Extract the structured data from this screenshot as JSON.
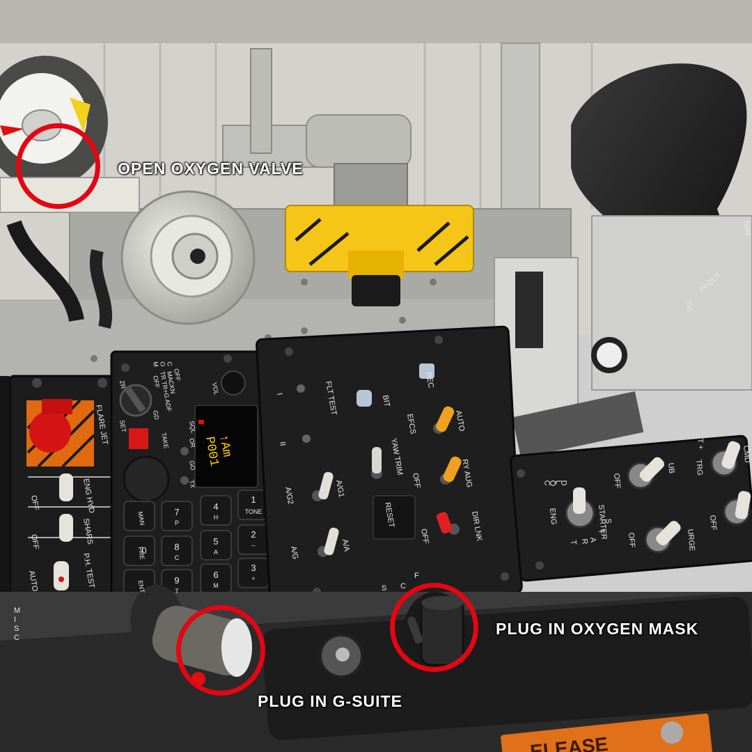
{
  "callouts": {
    "oxygen_valve": "OPEN OXYGEN VALVE",
    "oxygen_mask": "PLUG IN OXYGEN MASK",
    "g_suit": "PLUG IN G-SUITE"
  },
  "flt_test_panel": {
    "title": "FLT TEST",
    "rec": "REC",
    "bit": "BIT",
    "efcs": "EFCS",
    "auto": "AUTO",
    "yaw_trim": "YAW TRIM",
    "ry_aug": "RY AUG",
    "off1": "OFF",
    "off2": "OFF",
    "reset": "RESET",
    "dir_lnk": "DIR LNK",
    "ag1": "A/G1",
    "ag2": "A/G2",
    "ag": "A/G",
    "aa": "A/A",
    "pos_1": "I",
    "pos_2": "II",
    "fcs": [
      "F",
      "C",
      "S"
    ]
  },
  "ufc_panel": {
    "display_line1": "P001",
    "display_line2": "↑Am",
    "vol": "VOL",
    "tone": "TONE",
    "man": "MAN",
    "pre": "PRE",
    "ent": "ENT",
    "go": "GO",
    "tx": "TX",
    "sql": "SQL",
    "or": "OR",
    "take": "TAKE",
    "set": "SET",
    "zr": "ZR",
    "mode_labels": [
      "C",
      "O",
      "M",
      "OFF",
      "MACKN",
      "TR TR+G ADF",
      "OFF",
      "GD"
    ],
    "keys": [
      {
        "num": "1",
        "sub": ""
      },
      {
        "num": "4",
        "sub": "H"
      },
      {
        "num": "7",
        "sub": "P"
      },
      {
        "num": "2",
        "sub": "–"
      },
      {
        "num": "5",
        "sub": "A"
      },
      {
        "num": "8",
        "sub": "C"
      },
      {
        "num": "3",
        "sub": "+"
      },
      {
        "num": "6",
        "sub": "M"
      },
      {
        "num": "9",
        "sub": "T"
      },
      {
        "num": "0",
        "sub": "C"
      }
    ]
  },
  "left_panel": {
    "flare_jet": "FLARE JET",
    "eng_hyd": "ENG HYD",
    "shars": "SHARS",
    "ph_test": "P.H. TEST",
    "off1": "OFF",
    "off2": "OFF",
    "auto": "AUTO",
    "misc": [
      "M",
      "I",
      "S",
      "C"
    ]
  },
  "right_panel": {
    "cold": [
      "C",
      "O",
      "L",
      "D"
    ],
    "starter": "STARTER",
    "eng": "ENG",
    "start": [
      "S",
      "T",
      "A",
      "R",
      "T"
    ],
    "off1": "OFF",
    "off2": "OFF",
    "off3": "OFF",
    "trg": "TRG",
    "ub": "UB",
    "urge": "URGE",
    "t_plus": "T +",
    "cmd": "CMD"
  },
  "stick": {
    "in_out": "IN  OUT",
    "nav": "NAV",
    "tdc": "TDC"
  },
  "bottom_strip": {
    "release": "ELEASE"
  },
  "colors": {
    "ring": "#e30613",
    "panel": "#1c1c1c",
    "yellow_handle": "#f5c518",
    "toggle_orange": "#f0a020",
    "display_yellow": "#ffcc00"
  }
}
